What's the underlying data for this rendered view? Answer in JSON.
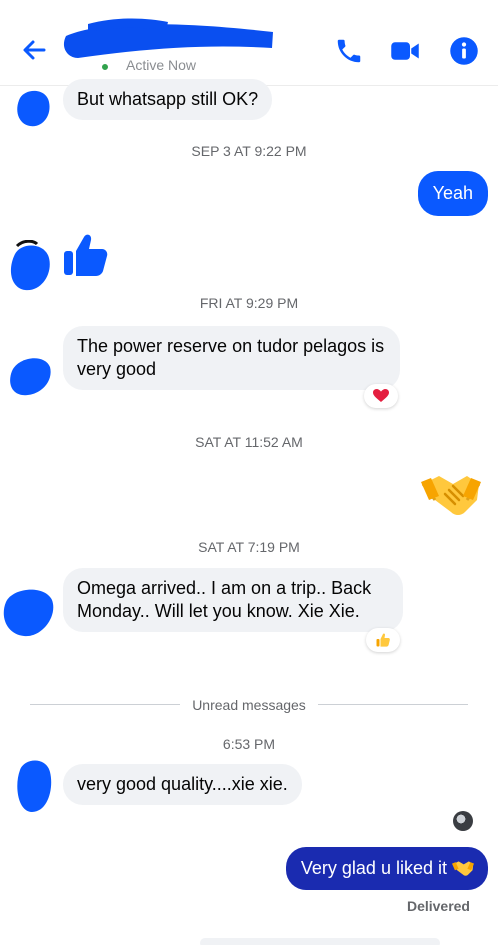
{
  "header": {
    "active_status": "Active Now",
    "accent": "#0a59ff"
  },
  "messages": {
    "m1": "But whatsapp still OK?",
    "ts1": "SEP 3 AT 9:22 PM",
    "m2": "Yeah",
    "ts2": "FRI AT 9:29 PM",
    "m3": "The power reserve on tudor pelagos is very good",
    "ts3": "SAT AT 11:52 AM",
    "ts4": "SAT AT 7:19 PM",
    "m4": "Omega arrived.. I am on a trip.. Back Monday.. Will let you know. Xie Xie.",
    "unread": "Unread messages",
    "ts5": "6:53 PM",
    "m5": "very good quality....xie xie.",
    "m6": "Very glad u liked it",
    "delivered": "Delivered"
  },
  "icons": {
    "back": "arrow-left-icon",
    "call": "phone-icon",
    "video": "video-camera-icon",
    "info": "info-icon",
    "thumbs_up": "thumbs-up-icon",
    "handshake": "handshake-emoji",
    "heart": "heart-reaction",
    "thumb_reaction": "thumbs-up-reaction"
  }
}
